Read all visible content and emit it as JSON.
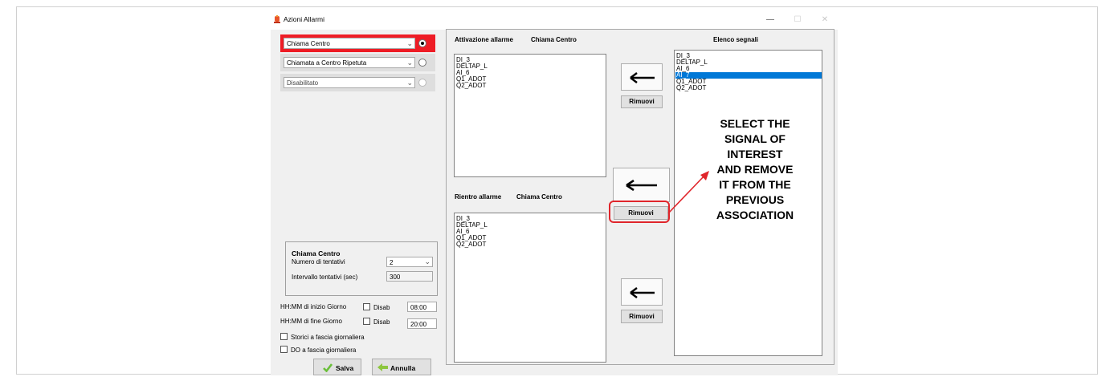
{
  "window": {
    "title": "Azioni Allarmi",
    "controls": {
      "minimize": "—",
      "maximize": "☐",
      "close": "✕"
    }
  },
  "left": {
    "actions": [
      {
        "value": "Chiama Centro",
        "selected": true
      },
      {
        "value": "Chiamata a Centro Ripetuta",
        "selected": false
      },
      {
        "value": "Disabilitato",
        "selected": false
      }
    ],
    "group": {
      "title": "Chiama Centro",
      "attempts_label": "Numero di tentativi",
      "attempts_value": "2",
      "interval_label": "Intervallo tentativi (sec)",
      "interval_value": "300"
    },
    "start": {
      "label": "HH:MM di inizio Giorno",
      "disab_label": "Disab",
      "value": "08:00"
    },
    "end": {
      "label": "HH:MM di fine Giorno",
      "disab_label": "Disab",
      "value": "20:00"
    },
    "storici_label": "Storici a fascia giornaliera",
    "do_label": "DO a fascia giornaliera",
    "save_label": "Salva",
    "cancel_label": "Annulla"
  },
  "activation": {
    "label": "Attivazione allarme",
    "target": "Chiama Centro",
    "items": [
      "DI_3",
      "DELTAP_L",
      "AI_6",
      "Q1_ADOT",
      "Q2_ADOT"
    ]
  },
  "rientro": {
    "label": "Rientro allarme",
    "target": "Chiama Centro",
    "items": [
      "DI_3",
      "DELTAP_L",
      "AI_6",
      "Q1_ADOT",
      "Q2_ADOT"
    ]
  },
  "signals": {
    "label": "Elenco segnali",
    "items": [
      "DI_3",
      "DELTAP_L",
      "AI_6",
      "AI_7",
      "Q1_ADOT",
      "Q2_ADOT"
    ],
    "selected_item": "AI_7"
  },
  "buttons": {
    "arrow": "←",
    "remove_label": "Rimuovi"
  },
  "annotation": {
    "lines": [
      "SELECT THE",
      "SIGNAL OF",
      "INTEREST",
      "AND REMOVE",
      "IT FROM THE",
      "PREVIOUS",
      "ASSOCIATION"
    ],
    "highlight_color": "#e0252b"
  },
  "colors": {
    "active_row": "#ee1c25",
    "selection": "#0078d7",
    "save_icon": "#6abf3a",
    "cancel_icon": "#8dc63f"
  }
}
